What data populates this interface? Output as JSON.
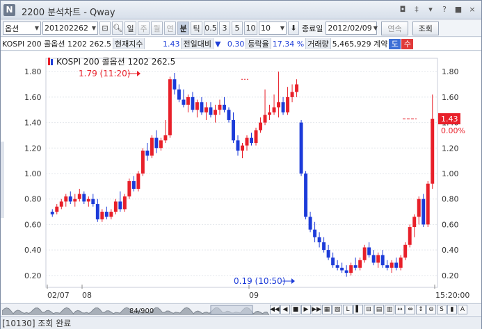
{
  "window": {
    "logo": "N",
    "title": "2200 분석차트 - Qway",
    "buttons": [
      "◘",
      "‡",
      "▾",
      "?",
      "■",
      "×"
    ]
  },
  "toolbar": {
    "asset_type": "옵션",
    "code": "201202262",
    "search_icon": "search-icon",
    "period_tabs": [
      "일",
      "주",
      "월",
      "연",
      "분",
      "틱"
    ],
    "active_tab": "분",
    "intervals": [
      "0.5",
      "3",
      "5",
      "10"
    ],
    "interval_select": "10",
    "end_date_label": "종료일",
    "end_date": "2012/02/09",
    "continuous_label": "연속",
    "query_label": "조회"
  },
  "info": {
    "name": "KOSPI 200 콜옵션 1202 262.5",
    "current_label": "현재지수",
    "current": "1.43",
    "change_label": "전일대비",
    "change_arrow": "▼",
    "change": "0.30",
    "rate_label": "등락율",
    "rate": "17.34 %",
    "volume_label": "거래량",
    "volume": "5,465,929 계약",
    "b1": "도",
    "b2": "수"
  },
  "chart_data": {
    "type": "candlestick",
    "legend": "KOSPI 200 콜옵션 1202 262.5",
    "x_labels": [
      "02/07",
      "08",
      "09",
      "15:20:00"
    ],
    "y_ticks": [
      "1.80",
      "1.60",
      "1.40",
      "1.20",
      "1.00",
      "0.80",
      "0.60",
      "0.40",
      "0.20"
    ],
    "ylim": [
      0.15,
      1.85
    ],
    "max_annotation": "1.79 (11:20)",
    "min_annotation": "0.19 (10:50)",
    "price_tag": "1.43",
    "price_pct": "0.00%",
    "up_color": "#e8202a",
    "down_color": "#1c3bd9",
    "candles": [
      [
        0.7,
        0.72,
        0.66,
        0.68
      ],
      [
        0.7,
        0.76,
        0.68,
        0.74
      ],
      [
        0.74,
        0.8,
        0.72,
        0.78
      ],
      [
        0.78,
        0.84,
        0.74,
        0.82
      ],
      [
        0.82,
        0.86,
        0.76,
        0.78
      ],
      [
        0.78,
        0.84,
        0.74,
        0.8
      ],
      [
        0.8,
        0.88,
        0.78,
        0.84
      ],
      [
        0.84,
        0.86,
        0.76,
        0.78
      ],
      [
        0.78,
        0.82,
        0.74,
        0.8
      ],
      [
        0.8,
        0.84,
        0.74,
        0.76
      ],
      [
        0.76,
        0.8,
        0.62,
        0.64
      ],
      [
        0.64,
        0.72,
        0.62,
        0.7
      ],
      [
        0.7,
        0.74,
        0.64,
        0.66
      ],
      [
        0.66,
        0.72,
        0.64,
        0.7
      ],
      [
        0.7,
        0.8,
        0.68,
        0.78
      ],
      [
        0.78,
        0.86,
        0.7,
        0.72
      ],
      [
        0.72,
        0.84,
        0.7,
        0.82
      ],
      [
        0.82,
        0.96,
        0.8,
        0.94
      ],
      [
        0.94,
        0.98,
        0.86,
        0.88
      ],
      [
        0.88,
        1.02,
        0.86,
        1.0
      ],
      [
        1.0,
        1.2,
        0.98,
        1.18
      ],
      [
        1.18,
        1.24,
        1.1,
        1.14
      ],
      [
        1.14,
        1.3,
        1.12,
        1.28
      ],
      [
        1.28,
        1.34,
        1.16,
        1.2
      ],
      [
        1.2,
        1.28,
        1.18,
        1.26
      ],
      [
        1.26,
        1.42,
        1.24,
        1.3
      ],
      [
        1.3,
        1.76,
        1.28,
        1.74
      ],
      [
        1.74,
        1.79,
        1.62,
        1.66
      ],
      [
        1.66,
        1.7,
        1.56,
        1.58
      ],
      [
        1.58,
        1.66,
        1.52,
        1.54
      ],
      [
        1.54,
        1.62,
        1.48,
        1.6
      ],
      [
        1.6,
        1.64,
        1.48,
        1.5
      ],
      [
        1.5,
        1.58,
        1.44,
        1.56
      ],
      [
        1.56,
        1.6,
        1.46,
        1.48
      ],
      [
        1.48,
        1.56,
        1.42,
        1.52
      ],
      [
        1.52,
        1.56,
        1.44,
        1.46
      ],
      [
        1.46,
        1.54,
        1.4,
        1.5
      ],
      [
        1.5,
        1.58,
        1.46,
        1.54
      ],
      [
        1.54,
        1.6,
        1.48,
        1.5
      ],
      [
        1.5,
        1.52,
        1.4,
        1.42
      ],
      [
        1.42,
        1.48,
        1.24,
        1.26
      ],
      [
        1.26,
        1.3,
        1.14,
        1.18
      ],
      [
        1.18,
        1.24,
        1.12,
        1.22
      ],
      [
        1.22,
        1.3,
        1.18,
        1.28
      ],
      [
        1.28,
        1.32,
        1.22,
        1.24
      ],
      [
        1.24,
        1.36,
        1.22,
        1.34
      ],
      [
        1.34,
        1.44,
        1.32,
        1.4
      ],
      [
        1.4,
        1.66,
        1.38,
        1.46
      ],
      [
        1.46,
        1.54,
        1.42,
        1.48
      ],
      [
        1.48,
        1.62,
        1.46,
        1.52
      ],
      [
        1.52,
        1.8,
        1.44,
        1.56
      ],
      [
        1.56,
        1.6,
        1.46,
        1.48
      ],
      [
        1.48,
        1.68,
        1.46,
        1.6
      ],
      [
        1.6,
        1.7,
        1.56,
        1.64
      ],
      [
        1.64,
        1.74,
        1.6,
        1.7
      ],
      [
        1.4,
        1.42,
        0.98,
        1.0
      ],
      [
        1.0,
        1.02,
        0.64,
        0.66
      ],
      [
        0.66,
        0.7,
        0.54,
        0.56
      ],
      [
        0.56,
        0.62,
        0.46,
        0.5
      ],
      [
        0.5,
        0.54,
        0.42,
        0.46
      ],
      [
        0.46,
        0.5,
        0.38,
        0.4
      ],
      [
        0.4,
        0.44,
        0.32,
        0.34
      ],
      [
        0.34,
        0.38,
        0.26,
        0.28
      ],
      [
        0.28,
        0.32,
        0.24,
        0.26
      ],
      [
        0.26,
        0.3,
        0.22,
        0.24
      ],
      [
        0.24,
        0.28,
        0.19,
        0.22
      ],
      [
        0.22,
        0.3,
        0.2,
        0.28
      ],
      [
        0.28,
        0.34,
        0.24,
        0.26
      ],
      [
        0.26,
        0.34,
        0.24,
        0.32
      ],
      [
        0.32,
        0.44,
        0.3,
        0.42
      ],
      [
        0.42,
        0.46,
        0.34,
        0.36
      ],
      [
        0.36,
        0.4,
        0.28,
        0.3
      ],
      [
        0.3,
        0.38,
        0.26,
        0.36
      ],
      [
        0.36,
        0.4,
        0.26,
        0.28
      ],
      [
        0.28,
        0.32,
        0.24,
        0.26
      ],
      [
        0.26,
        0.32,
        0.22,
        0.3
      ],
      [
        0.3,
        0.34,
        0.24,
        0.26
      ],
      [
        0.26,
        0.36,
        0.24,
        0.34
      ],
      [
        0.34,
        0.46,
        0.32,
        0.44
      ],
      [
        0.44,
        0.6,
        0.42,
        0.58
      ],
      [
        0.58,
        0.68,
        0.5,
        0.66
      ],
      [
        0.66,
        0.82,
        0.6,
        0.8
      ],
      [
        0.8,
        0.84,
        0.58,
        0.6
      ],
      [
        0.6,
        0.94,
        0.58,
        0.92
      ],
      [
        0.92,
        1.62,
        0.88,
        1.43
      ]
    ]
  },
  "scroll": {
    "position": "84/900"
  },
  "status": {
    "message": "[10130] 조회 완료"
  }
}
